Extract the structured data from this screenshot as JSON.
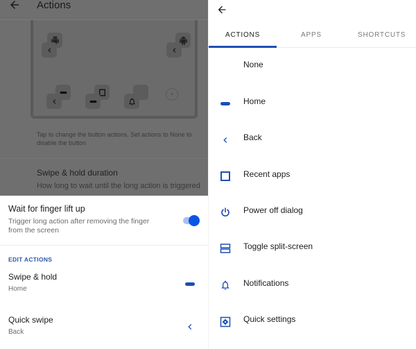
{
  "left": {
    "appbar": {
      "title": "Actions",
      "back_icon": "arrow-back-icon"
    },
    "preview": {
      "buttons": [
        {
          "primary": "back",
          "secondary": "android"
        },
        {
          "primary": "back",
          "secondary": "android"
        },
        {
          "primary": "back",
          "secondary": "home"
        },
        {
          "primary": "home",
          "secondary": "recent-apps"
        },
        {
          "primary": "notifications",
          "secondary": "none"
        }
      ],
      "add_icon": "add-circle-icon"
    },
    "hint": "Tap to change the button actions. Set actions to None to disable the button",
    "duration": {
      "title": "Swipe & hold duration",
      "subtitle": "How long to wait until the long action is triggered"
    },
    "sheet": {
      "wait_title": "Wait for finger lift up",
      "wait_subtitle": "Trigger long action after removing the finger from the screen",
      "wait_enabled": true,
      "section_header": "EDIT ACTIONS",
      "rows": [
        {
          "title": "Swipe & hold",
          "value": "Home",
          "icon": "home-pill-icon"
        },
        {
          "title": "Quick swipe",
          "value": "Back",
          "icon": "chevron-left-icon"
        }
      ]
    }
  },
  "right": {
    "back_icon": "arrow-back-icon",
    "tabs": [
      {
        "label": "ACTIONS",
        "active": true
      },
      {
        "label": "APPS",
        "active": false
      },
      {
        "label": "SHORTCUTS",
        "active": false
      }
    ],
    "items": [
      {
        "label": "None",
        "icon": "none"
      },
      {
        "label": "Home",
        "icon": "home-pill-icon"
      },
      {
        "label": "Back",
        "icon": "chevron-left-icon"
      },
      {
        "label": "Recent apps",
        "icon": "square-icon"
      },
      {
        "label": "Power off dialog",
        "icon": "power-icon"
      },
      {
        "label": "Toggle split-screen",
        "icon": "split-screen-icon"
      },
      {
        "label": "Notifications",
        "icon": "bell-icon"
      },
      {
        "label": "Quick settings",
        "icon": "settings-box-icon"
      }
    ]
  },
  "colors": {
    "accent": "#1d4fb3",
    "toggle_thumb": "#0a55e6",
    "toggle_track": "#a9bff2",
    "scrim": "#6f6f6f"
  }
}
